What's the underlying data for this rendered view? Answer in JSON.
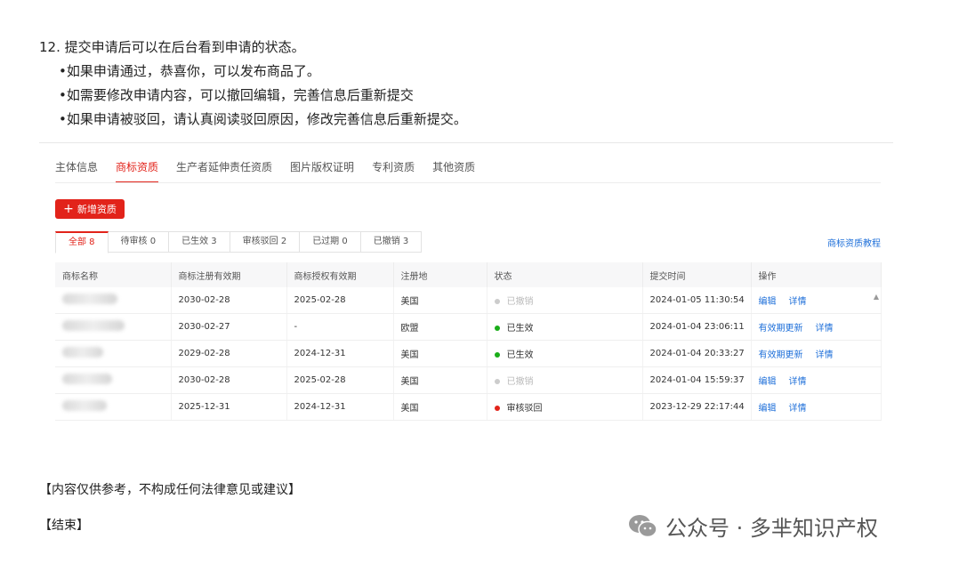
{
  "intro": {
    "heading": "12. 提交申请后可以在后台看到申请的状态。",
    "bullets": [
      "•如果申请通过，恭喜你，可以发布商品了。",
      "•如需要修改申请内容，可以撤回编辑，完善信息后重新提交",
      "•如果申请被驳回，请认真阅读驳回原因，修改完善信息后重新提交。"
    ]
  },
  "tabs": [
    "主体信息",
    "商标资质",
    "生产者延伸责任资质",
    "图片版权证明",
    "专利资质",
    "其他资质"
  ],
  "add_button": "新增资质",
  "subtabs": [
    "全部 8",
    "待审核 0",
    "已生效 3",
    "审核驳回 2",
    "已过期 0",
    "已撤销 3"
  ],
  "guide_link": "商标资质教程",
  "columns": [
    "商标名称",
    "商标注册有效期",
    "商标授权有效期",
    "注册地",
    "状态",
    "提交时间",
    "操作"
  ],
  "rows": [
    {
      "reg": "2030-02-28",
      "auth": "2025-02-28",
      "place": "美国",
      "status": "已撤销",
      "time": "2024-01-05 11:30:54",
      "actions": [
        "编辑",
        "详情"
      ]
    },
    {
      "reg": "2030-02-27",
      "auth": "-",
      "place": "欧盟",
      "status": "已生效",
      "time": "2024-01-04 23:06:11",
      "actions": [
        "有效期更新",
        "详情"
      ]
    },
    {
      "reg": "2029-02-28",
      "auth": "2024-12-31",
      "place": "美国",
      "status": "已生效",
      "time": "2024-01-04 20:33:27",
      "actions": [
        "有效期更新",
        "详情"
      ]
    },
    {
      "reg": "2030-02-28",
      "auth": "2025-02-28",
      "place": "美国",
      "status": "已撤销",
      "time": "2024-01-04 15:59:37",
      "actions": [
        "编辑",
        "详情"
      ]
    },
    {
      "reg": "2025-12-31",
      "auth": "2024-12-31",
      "place": "美国",
      "status": "审核驳回",
      "time": "2023-12-29 22:17:44",
      "actions": [
        "编辑",
        "详情"
      ]
    }
  ],
  "status_colors": {
    "已撤销": "#cccccc",
    "已生效": "#1aad19",
    "审核驳回": "#e2231a"
  },
  "note": "【内容仅供参考，不构成任何法律意见或建议】",
  "end": "【结束】",
  "footer": {
    "icon": "wechat-icon",
    "text": "公众号 · 多芈知识产权"
  }
}
